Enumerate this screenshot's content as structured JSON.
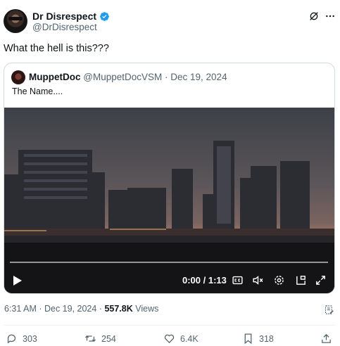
{
  "author": {
    "display_name": "Dr Disrespect",
    "handle": "@DrDisrespect"
  },
  "tweet": {
    "text": "What the hell is this???",
    "timestamp": "6:31 AM · Dec 19, 2024 · ",
    "views_count": "557.8K",
    "views_label": " Views"
  },
  "quote": {
    "display_name": "MuppetDoc",
    "handle": "@MuppetDocVSM",
    "date": " · Dec 19, 2024",
    "text": "The Name...."
  },
  "video": {
    "time": "0:00 / 1:13",
    "progress": 0
  },
  "actions": {
    "replies": "303",
    "reposts": "254",
    "likes": "6.4K",
    "bookmarks": "318"
  },
  "icons": [
    "verified-icon",
    "grok-icon",
    "more-icon",
    "play-icon",
    "captions-icon",
    "mute-icon",
    "settings-icon",
    "pip-icon",
    "fullscreen-icon",
    "community-notes-icon",
    "reply-icon",
    "repost-icon",
    "like-icon",
    "bookmark-icon",
    "share-icon"
  ],
  "colors": {
    "verified": "#1d9bf0",
    "secondary_text": "#536471",
    "border": "#cfd9de"
  }
}
